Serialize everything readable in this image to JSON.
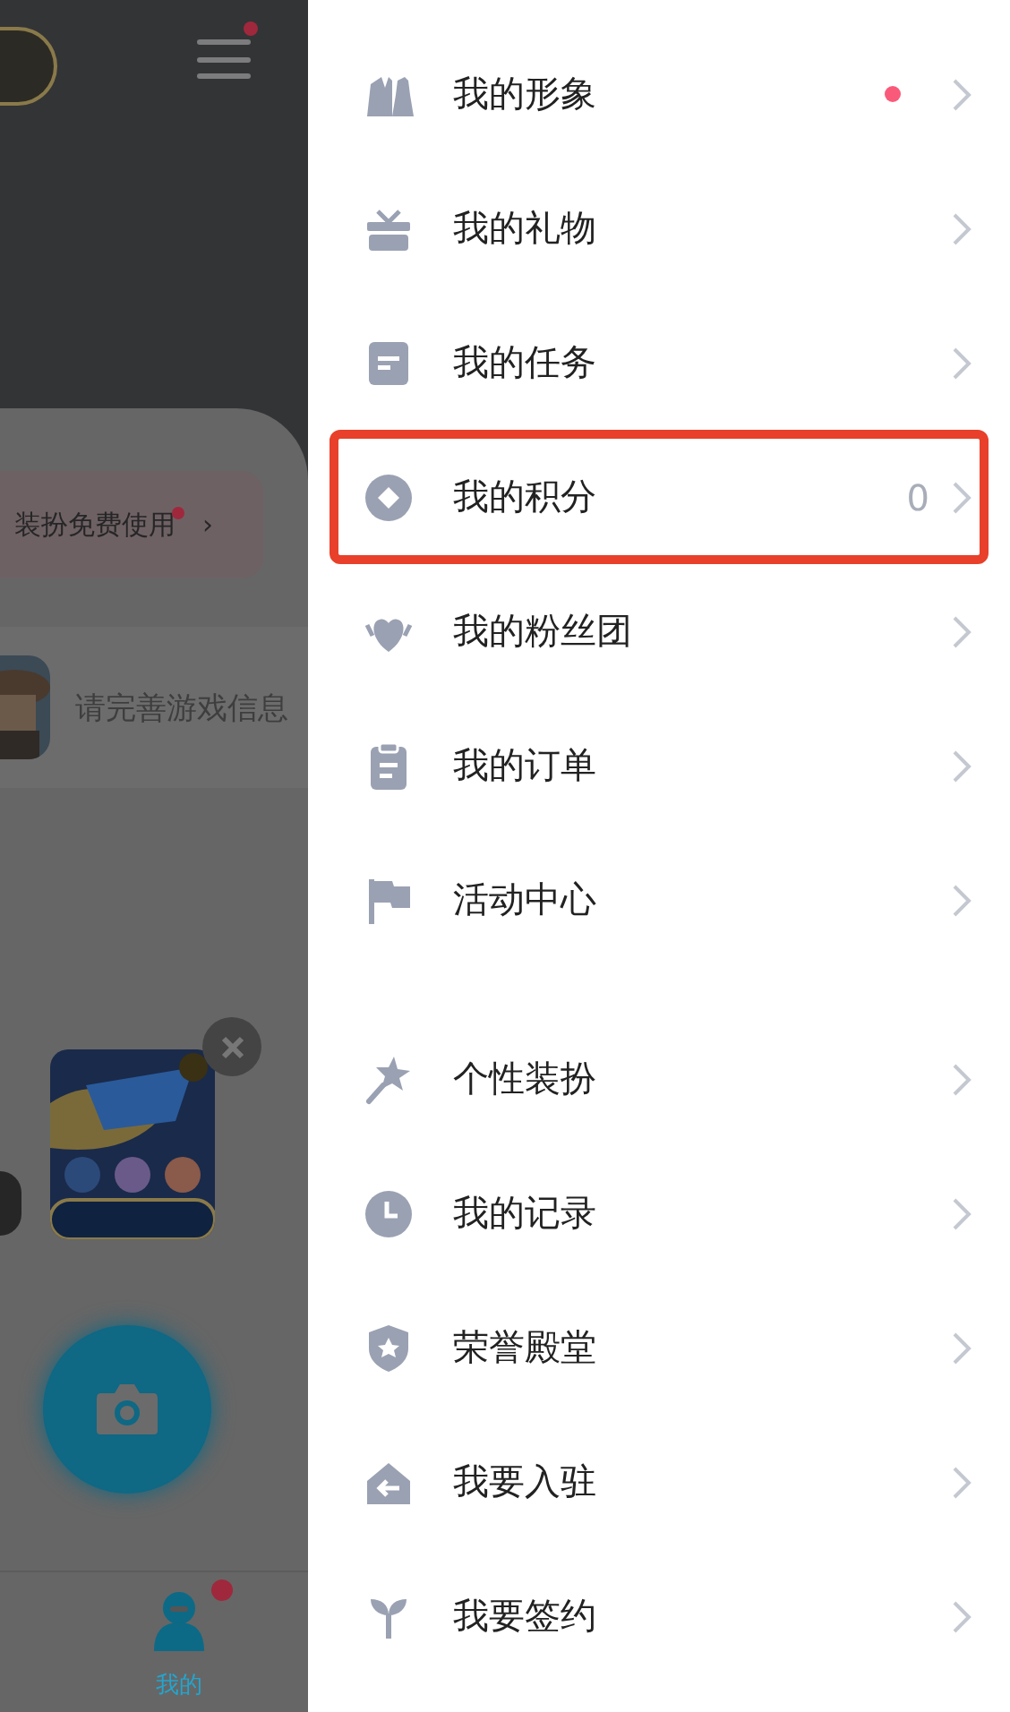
{
  "background": {
    "menu_badge": true,
    "banner": {
      "text": "装扮免费使用",
      "badge": true,
      "arrow": "›"
    },
    "game_prompt": {
      "text": "请完善游戏信息"
    },
    "bottom_nav": {
      "label": "我的",
      "badge": true
    }
  },
  "drawer": {
    "groups": [
      {
        "items": [
          {
            "kind": "outfit",
            "label": "我的形象",
            "dot": true,
            "highlighted": false
          },
          {
            "kind": "gift",
            "label": "我的礼物",
            "dot": false,
            "highlighted": false
          },
          {
            "kind": "task",
            "label": "我的任务",
            "dot": false,
            "highlighted": false
          },
          {
            "kind": "points",
            "label": "我的积分",
            "value": "0",
            "dot": false,
            "highlighted": true
          },
          {
            "kind": "fans",
            "label": "我的粉丝团",
            "dot": false,
            "highlighted": false
          },
          {
            "kind": "order",
            "label": "我的订单",
            "dot": false,
            "highlighted": false
          },
          {
            "kind": "flag",
            "label": "活动中心",
            "dot": false,
            "highlighted": false
          }
        ]
      },
      {
        "items": [
          {
            "kind": "wand",
            "label": "个性装扮",
            "dot": false,
            "highlighted": false
          },
          {
            "kind": "clock",
            "label": "我的记录",
            "dot": false,
            "highlighted": false
          },
          {
            "kind": "shield",
            "label": "荣誉殿堂",
            "dot": false,
            "highlighted": false
          },
          {
            "kind": "enter",
            "label": "我要入驻",
            "dot": false,
            "highlighted": false
          },
          {
            "kind": "sprout",
            "label": "我要签约",
            "dot": false,
            "highlighted": false
          }
        ]
      }
    ]
  }
}
